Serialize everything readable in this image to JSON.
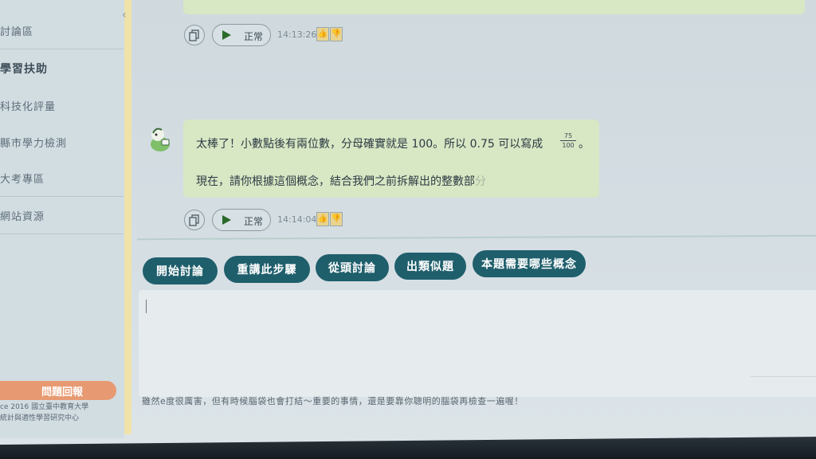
{
  "sidebar": {
    "items": [
      {
        "label": "討論區"
      },
      {
        "label": "學習扶助"
      },
      {
        "label": "科技化評量"
      },
      {
        "label": "縣市學力檢測"
      },
      {
        "label": "大考專區"
      },
      {
        "label": "網站資源"
      }
    ],
    "report_button": "問題回報",
    "copyright_line1": "ce 2016 國立臺中教育大學",
    "copyright_line2": "統計與適性學習研究中心"
  },
  "chat": {
    "prev_message_fragment": "…………………………………",
    "prev_time": "14:13:26",
    "message_line1": "太棒了！小數點後有兩位數，分母確實就是 100。所以 0.75 可以寫成",
    "fraction_num": "75",
    "fraction_den": "100",
    "fraction_after": "。",
    "message_line2": "現在，請你根據這個概念，結合我們之前拆解出的整數部",
    "message_line2_fade": "分",
    "speed_label": "正常",
    "msg_time": "14:14:04"
  },
  "quick_actions": {
    "start": "開始討論",
    "repeat": "重講此步驟",
    "restart": "從頭討論",
    "similar": "出類似題",
    "concepts": "本題需要哪些概念"
  },
  "input": {
    "hint": "雖然e度很厲害，但有時候腦袋也會打結～重要的事情，還是要靠你聰明的腦袋再檢查一遍喔！"
  },
  "colors": {
    "accent": "#1f5f6c",
    "bubble": "#d8e7c4",
    "report": "#e79a72"
  }
}
